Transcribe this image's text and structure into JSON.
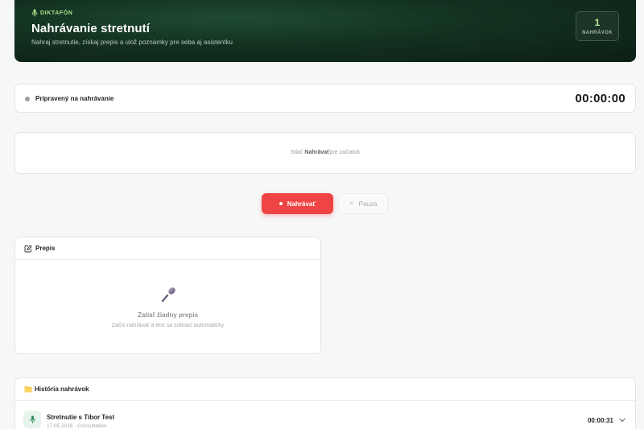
{
  "header": {
    "brand": "DIKTAFÓN",
    "title": "Nahrávanie stretnutí",
    "subtitle": "Nahraj stretnutie, získaj prepis a ulož poznámky pre seba aj asistentku",
    "stat": {
      "value": "1",
      "label": "NAHRÁVOK"
    }
  },
  "status": {
    "label": "Pripravený na nahrávanie",
    "timer": "00:00:00"
  },
  "hint": {
    "prefix": "Stlač",
    "emphasis": "Nahrávať",
    "suffix": "pre začiatok"
  },
  "controls": {
    "record_label": "Nahrávať",
    "pause_label": "Pauza"
  },
  "transcript": {
    "title": "Prepis",
    "empty_title": "Zatiaľ žiadny prepis",
    "empty_subtitle": "Začni nahrávať a text sa zobrazí automaticky"
  },
  "history": {
    "title": "História nahrávok",
    "items": [
      {
        "name": "Stretnutie s Tibor Test",
        "meta": "17.05.2026 · Consultation",
        "duration": "00:00:31"
      }
    ]
  },
  "colors": {
    "accent_red": "#ef4444",
    "brand_green": "#a9e28a",
    "hero_bg": "#12301f"
  },
  "icons": {
    "brand": "microphone-icon",
    "transcript": "edit-icon",
    "empty": "microphone-icon",
    "history": "folder-icon",
    "row": "microphone-icon",
    "expand": "chevron-down-icon",
    "pause": "close-icon"
  }
}
